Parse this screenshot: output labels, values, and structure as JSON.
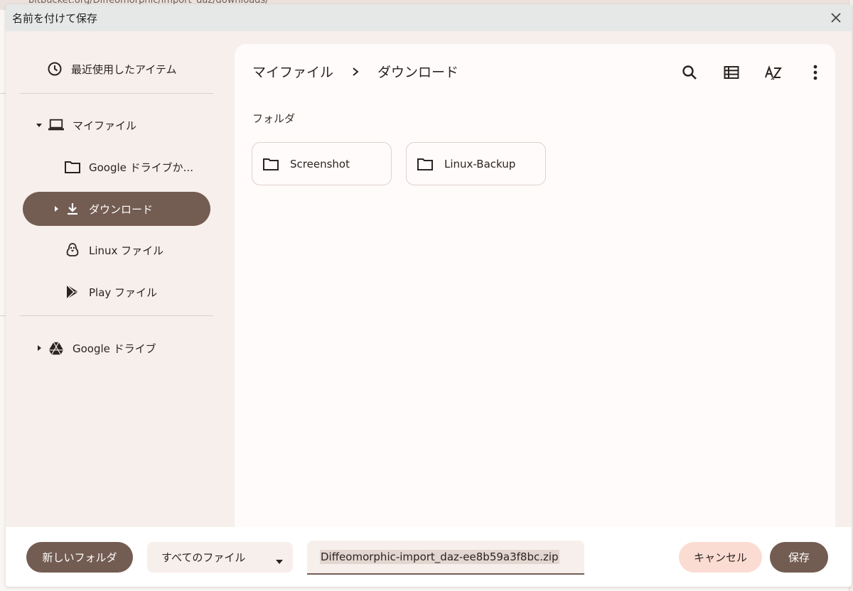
{
  "background": {
    "url_text": "bitbucket.org/Diffeomorphic/import_daz/downloads/"
  },
  "dialog": {
    "title": "名前を付けて保存",
    "close_icon": "close-icon"
  },
  "sidebar": {
    "recent": {
      "label": "最近使用したアイテム",
      "icon": "clock-icon"
    },
    "my_files": {
      "label": "マイファイル",
      "icon": "laptop-icon",
      "expanded": true
    },
    "google_drive_shortcut": {
      "label": "Google ドライブか...",
      "icon": "folder-icon"
    },
    "downloads": {
      "label": "ダウンロード",
      "icon": "download-icon",
      "active": true
    },
    "linux_files": {
      "label": "Linux ファイル",
      "icon": "penguin-icon"
    },
    "play_files": {
      "label": "Play ファイル",
      "icon": "play-store-icon"
    },
    "google_drive": {
      "label": "Google ドライブ",
      "icon": "google-drive-icon",
      "expanded": false
    }
  },
  "main": {
    "breadcrumb": [
      "マイファイル",
      "ダウンロード"
    ],
    "toolbar": [
      "search-icon",
      "list-view-icon",
      "sort-az-icon",
      "more-vert-icon"
    ],
    "section_title": "フォルダ",
    "folders": [
      {
        "name": "Screenshot"
      },
      {
        "name": "Linux-Backup"
      }
    ]
  },
  "footer": {
    "new_folder_label": "新しいフォルダ",
    "file_type_selected": "すべてのファイル",
    "filename_value": "Diffeomorphic-import_daz-ee8b59a3f8bc.zip",
    "cancel_label": "キャンセル",
    "save_label": "保存"
  },
  "colors": {
    "accent": "#735c52",
    "cancel_bg": "#fbdcd3",
    "sidebar_bg": "#f7efeb",
    "titlebar_bg": "#e6e8e7"
  }
}
